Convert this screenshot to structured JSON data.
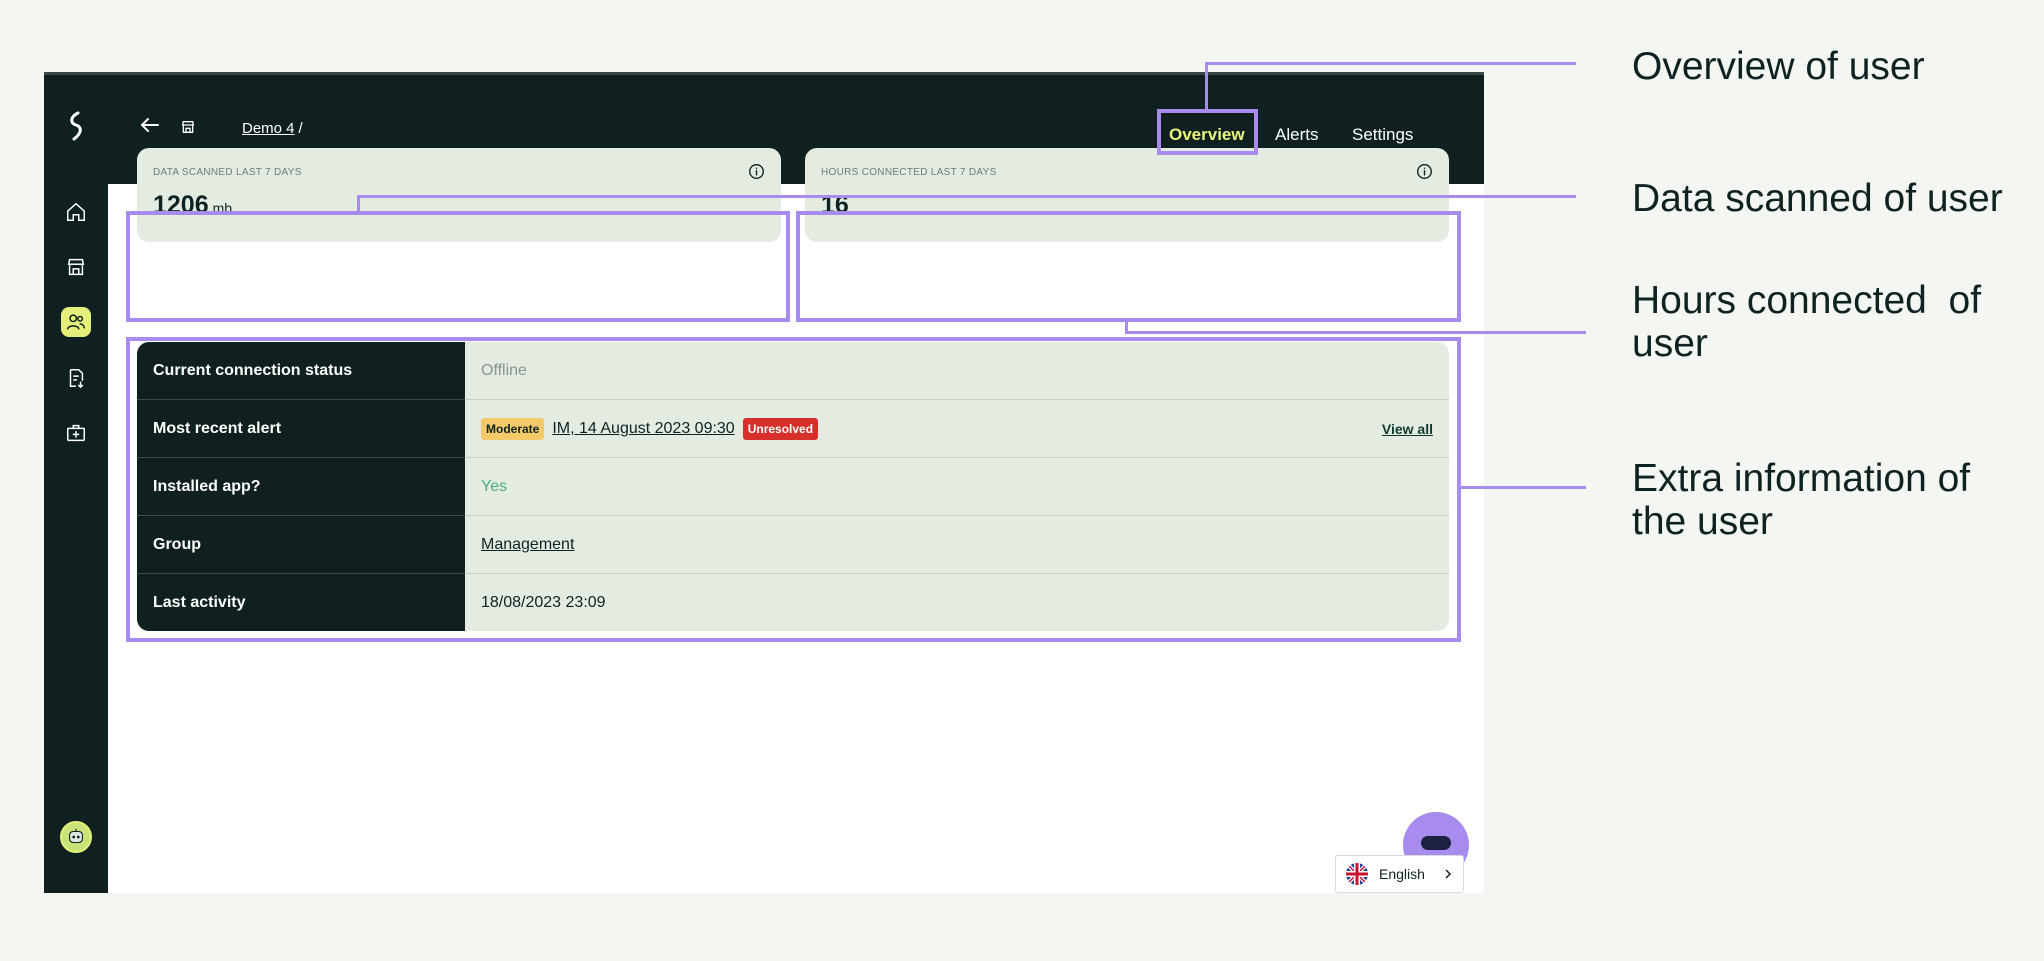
{
  "breadcrumb": {
    "workspace": "Demo 4",
    "separator": "/"
  },
  "tabs": [
    {
      "label": "Overview",
      "active": true
    },
    {
      "label": "Alerts",
      "active": false
    },
    {
      "label": "Settings",
      "active": false
    }
  ],
  "sidebar": {
    "items": [
      {
        "icon": "home-icon"
      },
      {
        "icon": "store-icon"
      },
      {
        "icon": "users-icon",
        "active": true
      },
      {
        "icon": "document-download-icon"
      },
      {
        "icon": "medical-kit-icon"
      }
    ]
  },
  "cards": {
    "data_scanned": {
      "label": "DATA SCANNED LAST 7 DAYS",
      "value": "1206",
      "unit": "mb"
    },
    "hours_connected": {
      "label": "HOURS CONNECTED LAST 7 DAYS",
      "value": "16"
    }
  },
  "info": {
    "connection_status": {
      "label": "Current connection status",
      "value": "Offline"
    },
    "recent_alert": {
      "label": "Most recent alert",
      "severity": "Moderate",
      "title": "IM, 14 August 2023 09:30",
      "status": "Unresolved",
      "view_all": "View all"
    },
    "installed_app": {
      "label": "Installed app?",
      "value": "Yes"
    },
    "group": {
      "label": "Group",
      "value": "Management"
    },
    "last_activity": {
      "label": "Last activity",
      "value": "18/08/2023 23:09"
    }
  },
  "language": {
    "label": "English"
  },
  "annotations": {
    "overview": "Overview of user",
    "data_scanned": "Data scanned of user",
    "hours_connected_1": "Hours connected  of",
    "hours_connected_2": "user",
    "extra_info_1": "Extra information of",
    "extra_info_2": "the user"
  },
  "colors": {
    "dark": "#102020",
    "accent": "#e9f57c",
    "annotation": "#a78bef",
    "panel": "#e4ece2",
    "moderate": "#f3c969",
    "unresolved": "#d7302a"
  }
}
